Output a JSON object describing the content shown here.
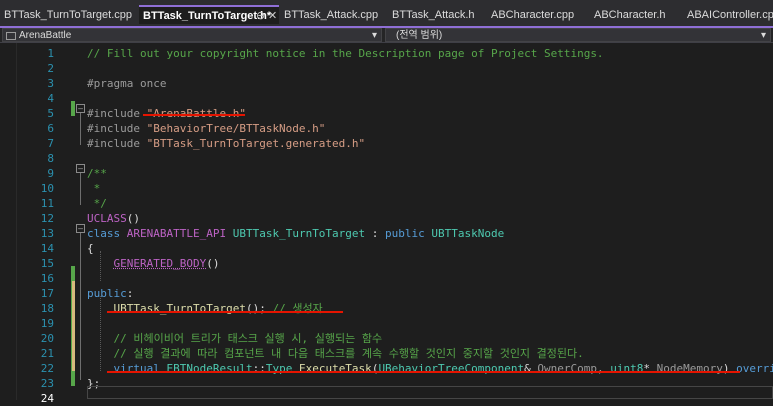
{
  "tabs": [
    {
      "label": "BTTask_TurnToTarget.cpp"
    },
    {
      "label": "BTTask_TurnToTarget.h*"
    },
    {
      "label": "BTTask_Attack.cpp"
    },
    {
      "label": "BTTask_Attack.h"
    },
    {
      "label": "ABCharacter.cpp"
    },
    {
      "label": "ABCharacter.h"
    },
    {
      "label": "ABAIController.cpp"
    }
  ],
  "active_tab_controls": {
    "pin": "⊖",
    "close": "✕"
  },
  "nav": {
    "project": "ArenaBattle",
    "scope": "(전역 범위)",
    "dropdown_glyph": "▾"
  },
  "lines": [
    {
      "n": "1",
      "t": [
        {
          "c": "cmt",
          "s": "// Fill out your copyright notice in the Description page of Project Settings."
        }
      ]
    },
    {
      "n": "2",
      "t": []
    },
    {
      "n": "3",
      "t": [
        {
          "c": "pp",
          "s": "#pragma once"
        }
      ]
    },
    {
      "n": "4",
      "t": []
    },
    {
      "n": "5",
      "t": [
        {
          "c": "pp",
          "s": "#include "
        },
        {
          "c": "str",
          "s": "\"ArenaBattle.h\""
        }
      ]
    },
    {
      "n": "6",
      "t": [
        {
          "c": "pp",
          "s": "#include "
        },
        {
          "c": "str",
          "s": "\"BehaviorTree/BTTaskNode.h\""
        }
      ]
    },
    {
      "n": "7",
      "t": [
        {
          "c": "pp",
          "s": "#include "
        },
        {
          "c": "str",
          "s": "\"BTTask_TurnToTarget.generated.h\""
        }
      ]
    },
    {
      "n": "8",
      "t": []
    },
    {
      "n": "9",
      "t": [
        {
          "c": "cmt",
          "s": "/**"
        }
      ]
    },
    {
      "n": "10",
      "t": [
        {
          "c": "cmt",
          "s": " *"
        }
      ]
    },
    {
      "n": "11",
      "t": [
        {
          "c": "cmt",
          "s": " */"
        }
      ]
    },
    {
      "n": "12",
      "t": [
        {
          "c": "mac",
          "s": "UCLASS"
        },
        {
          "c": "",
          "s": "()"
        }
      ]
    },
    {
      "n": "13",
      "t": [
        {
          "c": "kw",
          "s": "class "
        },
        {
          "c": "mac",
          "s": "ARENABATTLE_API "
        },
        {
          "c": "typ",
          "s": "UBTTask_TurnToTarget"
        },
        {
          "c": "",
          "s": " : "
        },
        {
          "c": "kw",
          "s": "public "
        },
        {
          "c": "typ",
          "s": "UBTTaskNode"
        }
      ]
    },
    {
      "n": "14",
      "t": [
        {
          "c": "",
          "s": "{"
        }
      ]
    },
    {
      "n": "15",
      "t": [
        {
          "c": "",
          "s": "    "
        },
        {
          "c": "mac under",
          "s": "GENERATED_BODY"
        },
        {
          "c": "",
          "s": "()"
        }
      ]
    },
    {
      "n": "16",
      "t": []
    },
    {
      "n": "17",
      "t": [
        {
          "c": "kw",
          "s": "public"
        },
        {
          "c": "",
          "s": ":"
        }
      ]
    },
    {
      "n": "18",
      "t": [
        {
          "c": "",
          "s": "    "
        },
        {
          "c": "fn",
          "s": "UBTTask_TurnToTarget"
        },
        {
          "c": "",
          "s": "(); "
        },
        {
          "c": "cmt",
          "s": "// 생성자"
        }
      ]
    },
    {
      "n": "19",
      "t": []
    },
    {
      "n": "20",
      "t": [
        {
          "c": "",
          "s": "    "
        },
        {
          "c": "cmt",
          "s": "// 비헤이비어 트리가 태스크 실행 시, 실행되는 함수"
        }
      ]
    },
    {
      "n": "21",
      "t": [
        {
          "c": "",
          "s": "    "
        },
        {
          "c": "cmt",
          "s": "// 실행 결과에 따라 컴포넌트 내 다음 태스크를 계속 수행할 것인지 중지할 것인지 결정된다."
        }
      ]
    },
    {
      "n": "22",
      "t": [
        {
          "c": "",
          "s": "    "
        },
        {
          "c": "kw",
          "s": "virtual "
        },
        {
          "c": "typ",
          "s": "EBTNodeResult"
        },
        {
          "c": "",
          "s": "::"
        },
        {
          "c": "typ",
          "s": "Type "
        },
        {
          "c": "fn",
          "s": "ExecuteTask"
        },
        {
          "c": "",
          "s": "("
        },
        {
          "c": "typ",
          "s": "UBehaviorTreeComponent"
        },
        {
          "c": "",
          "s": "& "
        },
        {
          "c": "par",
          "s": "OwnerComp"
        },
        {
          "c": "",
          "s": ", "
        },
        {
          "c": "typ",
          "s": "uint8"
        },
        {
          "c": "",
          "s": "* "
        },
        {
          "c": "par",
          "s": "NodeMemory"
        },
        {
          "c": "",
          "s": ") "
        },
        {
          "c": "kw",
          "s": "override"
        },
        {
          "c": "",
          "s": ";"
        }
      ]
    },
    {
      "n": "23",
      "t": [
        {
          "c": "",
          "s": "};"
        }
      ]
    },
    {
      "n": "24",
      "t": []
    }
  ]
}
